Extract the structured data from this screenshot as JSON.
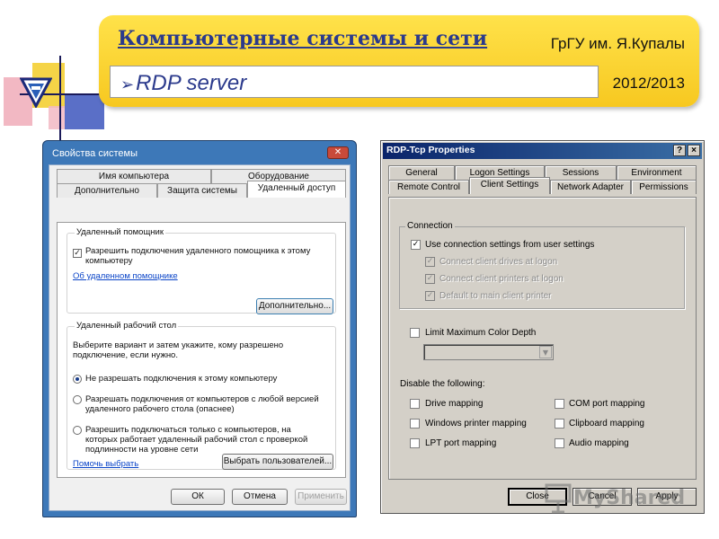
{
  "slide": {
    "title": "Компьютерные системы и сети",
    "university": "ГрГУ им. Я.Купалы",
    "subtitle": "RDP server",
    "subtitle_icon": "arrow-bullet-icon",
    "year": "2012/2013",
    "banner_color": "#f7c820",
    "title_color": "#2b3a8c"
  },
  "dialog_left": {
    "title": "Свойства системы",
    "tabs_row1": [
      "Имя компьютера",
      "Оборудование"
    ],
    "tabs_row2": [
      "Дополнительно",
      "Защита системы",
      "Удаленный доступ"
    ],
    "active_tab": "Удаленный доступ",
    "remote_assistance": {
      "group_label": "Удаленный помощник",
      "allow_label": "Разрешить подключения удаленного помощника к этому компьютеру",
      "allow_checked": true,
      "link": "Об удаленном помощнике",
      "advanced_button": "Дополнительно..."
    },
    "remote_desktop": {
      "group_label": "Удаленный рабочий стол",
      "instructions": "Выберите вариант и затем укажите, кому разрешено подключение, если нужно.",
      "options": [
        "Не разрешать подключения к этому компьютеру",
        "Разрешать подключения от компьютеров с любой версией удаленного рабочего стола (опаснее)",
        "Разрешить подключаться только с компьютеров, на которых работает удаленный рабочий стол с проверкой подлинности на уровне сети"
      ],
      "selected_option": 0,
      "help_link": "Помочь выбрать",
      "select_users_button": "Выбрать пользователей..."
    },
    "buttons": {
      "ok": "ОК",
      "cancel": "Отмена",
      "apply": "Применить"
    }
  },
  "dialog_right": {
    "title": "RDP-Tcp Properties",
    "title_buttons": [
      "?",
      "×"
    ],
    "tabs_row1": [
      "General",
      "Logon Settings",
      "Sessions",
      "Environment"
    ],
    "tabs_row2": [
      "Remote Control",
      "Client Settings",
      "Network Adapter",
      "Permissions"
    ],
    "active_tab": "Client Settings",
    "connection": {
      "group_label": "Connection",
      "use_user_settings": "Use connection settings from user settings",
      "use_user_settings_checked": true,
      "sub_options": [
        "Connect client drives at logon",
        "Connect client printers at logon",
        "Default to main client printer"
      ]
    },
    "limit_color_depth": "Limit Maximum Color Depth",
    "limit_color_depth_checked": false,
    "disable_label": "Disable the following:",
    "disable_options_left": [
      "Drive mapping",
      "Windows printer mapping",
      "LPT port mapping"
    ],
    "disable_options_right": [
      "COM port mapping",
      "Clipboard mapping",
      "Audio mapping"
    ],
    "buttons": {
      "close": "Close",
      "cancel": "Cancel",
      "apply": "Apply"
    }
  },
  "watermark": {
    "text": "MyShared",
    "icon": "presentation-board-icon"
  }
}
